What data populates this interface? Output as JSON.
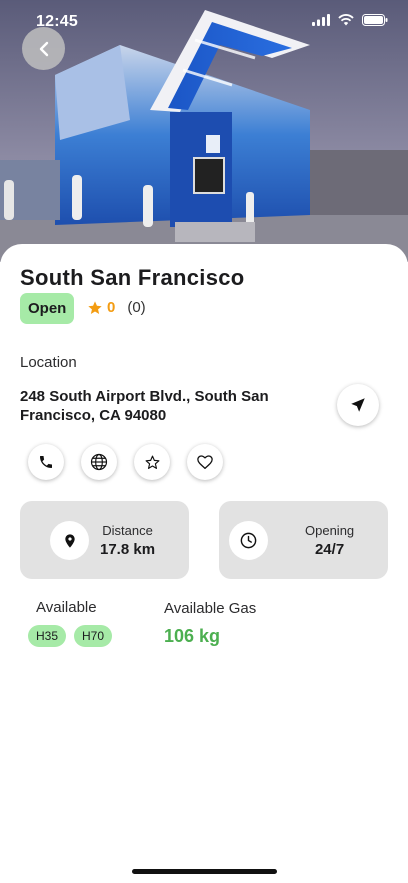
{
  "status_bar": {
    "time": "12:45",
    "icons": [
      "signal-icon",
      "wifi-icon",
      "battery-icon"
    ]
  },
  "hero": {
    "alt_icon": "hydrogen-station-photo"
  },
  "station": {
    "name": "South San Francisco",
    "status": "Open",
    "rating": "0",
    "review_count": "(0)",
    "location_label": "Location",
    "address": "248 South Airport Blvd., South San Francisco, CA 94080"
  },
  "actions": [
    "phone-icon",
    "globe-icon",
    "star-outline-icon",
    "heart-outline-icon"
  ],
  "cards": {
    "distance": {
      "label": "Distance",
      "value": "17.8 km"
    },
    "opening": {
      "label": "Opening",
      "value": "24/7"
    }
  },
  "availability": {
    "label": "Available",
    "tags": [
      "H35",
      "H70"
    ],
    "gas_label": "Available Gas",
    "gas_value": "106 kg"
  },
  "colors": {
    "open_badge": "#a6eaa7",
    "star": "#f39c12",
    "gas_value": "#4caf50",
    "card_bg": "#e2e2e2"
  }
}
